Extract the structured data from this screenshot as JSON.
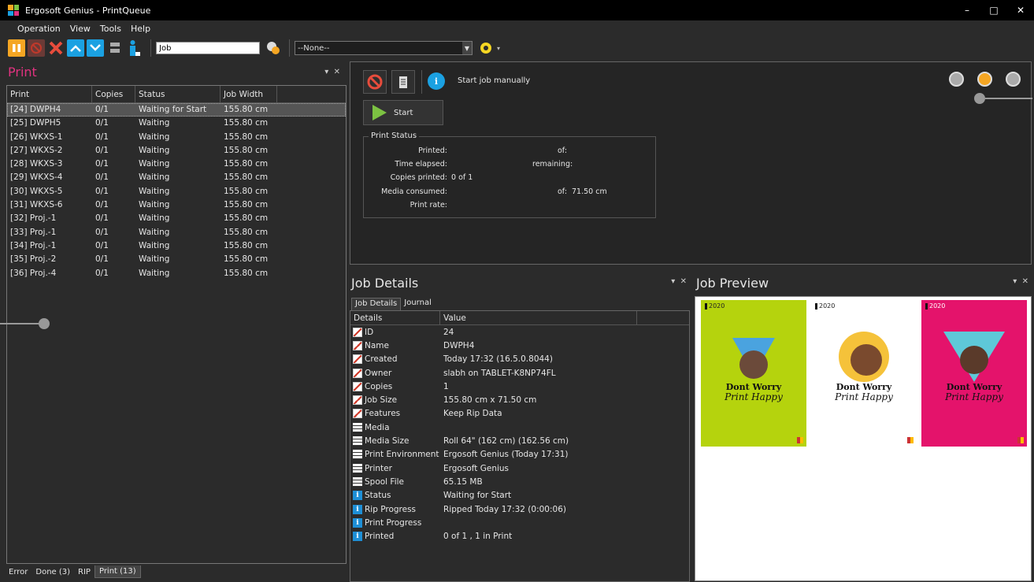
{
  "window": {
    "title": "Ergosoft Genius - PrintQueue",
    "controls": [
      "–",
      "□",
      "✕"
    ]
  },
  "menu": [
    "Operation",
    "View",
    "Tools",
    "Help"
  ],
  "toolbar": {
    "job_field_value": "Job",
    "filter_value": "--None--"
  },
  "print_panel": {
    "title": "Print",
    "columns": [
      "Print",
      "Copies",
      "Status",
      "Job Width"
    ],
    "rows": [
      [
        "[24] DWPH4",
        "0/1",
        "Waiting for Start",
        "155.80 cm"
      ],
      [
        "[25] DWPH5",
        "0/1",
        "Waiting",
        "155.80 cm"
      ],
      [
        "[26] WKXS-1",
        "0/1",
        "Waiting",
        "155.80 cm"
      ],
      [
        "[27] WKXS-2",
        "0/1",
        "Waiting",
        "155.80 cm"
      ],
      [
        "[28] WKXS-3",
        "0/1",
        "Waiting",
        "155.80 cm"
      ],
      [
        "[29] WKXS-4",
        "0/1",
        "Waiting",
        "155.80 cm"
      ],
      [
        "[30] WKXS-5",
        "0/1",
        "Waiting",
        "155.80 cm"
      ],
      [
        "[31] WKXS-6",
        "0/1",
        "Waiting",
        "155.80 cm"
      ],
      [
        "[32] Proj.-1",
        "0/1",
        "Waiting",
        "155.80 cm"
      ],
      [
        "[33] Proj.-1",
        "0/1",
        "Waiting",
        "155.80 cm"
      ],
      [
        "[34] Proj.-1",
        "0/1",
        "Waiting",
        "155.80 cm"
      ],
      [
        "[35] Proj.-2",
        "0/1",
        "Waiting",
        "155.80 cm"
      ],
      [
        "[36] Proj.-4",
        "0/1",
        "Waiting",
        "155.80 cm"
      ]
    ],
    "selected_row": 0
  },
  "bottom_tabs": [
    "Error",
    "Done (3)",
    "RIP",
    "Print (13)"
  ],
  "control": {
    "mode_text": "Start job manually",
    "start_label": "Start",
    "status_title": "Print Status",
    "printed_label": "Printed:",
    "of_label": "of:",
    "time_elapsed_label": "Time elapsed:",
    "remaining_label": "remaining:",
    "copies_printed_label": "Copies printed:",
    "copies_printed_value": "0 of 1",
    "media_consumed_label": "Media consumed:",
    "media_of_label": "of:",
    "media_of_value": "71.50 cm",
    "print_rate_label": "Print rate:"
  },
  "details": {
    "title": "Job Details",
    "tabs": [
      "Job Details",
      "Journal"
    ],
    "columns": [
      "Details",
      "Value"
    ],
    "rows": [
      {
        "icon": "doc",
        "key": "ID",
        "value": "24"
      },
      {
        "icon": "doc",
        "key": "Name",
        "value": "DWPH4"
      },
      {
        "icon": "doc",
        "key": "Created",
        "value": "Today 17:32 (16.5.0.8044)"
      },
      {
        "icon": "doc",
        "key": "Owner",
        "value": "slabh  on TABLET-K8NP74FL"
      },
      {
        "icon": "doc",
        "key": "Copies",
        "value": "1"
      },
      {
        "icon": "doc",
        "key": "Job Size",
        "value": "155.80 cm x 71.50 cm"
      },
      {
        "icon": "doc",
        "key": "Features",
        "value": "Keep Rip Data"
      },
      {
        "icon": "media",
        "key": "Media",
        "value": ""
      },
      {
        "icon": "media",
        "key": "Media Size",
        "value": "Roll 64\" (162 cm) (162.56 cm)"
      },
      {
        "icon": "media",
        "key": "Print Environment",
        "value": "Ergosoft Genius (Today 17:31)"
      },
      {
        "icon": "media",
        "key": "Printer",
        "value": "Ergosoft Genius"
      },
      {
        "icon": "media",
        "key": "Spool File",
        "value": "65.15 MB"
      },
      {
        "icon": "info",
        "key": "Status",
        "value": "Waiting for Start"
      },
      {
        "icon": "info",
        "key": "Rip Progress",
        "value": "Ripped Today 17:32 (0:00:06)"
      },
      {
        "icon": "info",
        "key": "Print Progress",
        "value": ""
      },
      {
        "icon": "info",
        "key": "Printed",
        "value": "0 of 1 , 1 in Print"
      }
    ]
  },
  "preview": {
    "title": "Job Preview",
    "posters": [
      {
        "year": "2020",
        "line1": "Dont Worry",
        "line2": "Print Happy",
        "bg": "#b5d30d"
      },
      {
        "year": "2020",
        "line1": "Dont Worry",
        "line2": "Print Happy",
        "bg": "#ffffff"
      },
      {
        "year": "2020",
        "line1": "Dont Worry",
        "line2": "Print Happy",
        "bg": "#e4136b"
      }
    ]
  },
  "colors": {
    "accent_pink": "#e0327f",
    "pause_orange": "#f5a623",
    "nav_blue": "#1ba1e2",
    "lamp_active": "#f5a623"
  }
}
